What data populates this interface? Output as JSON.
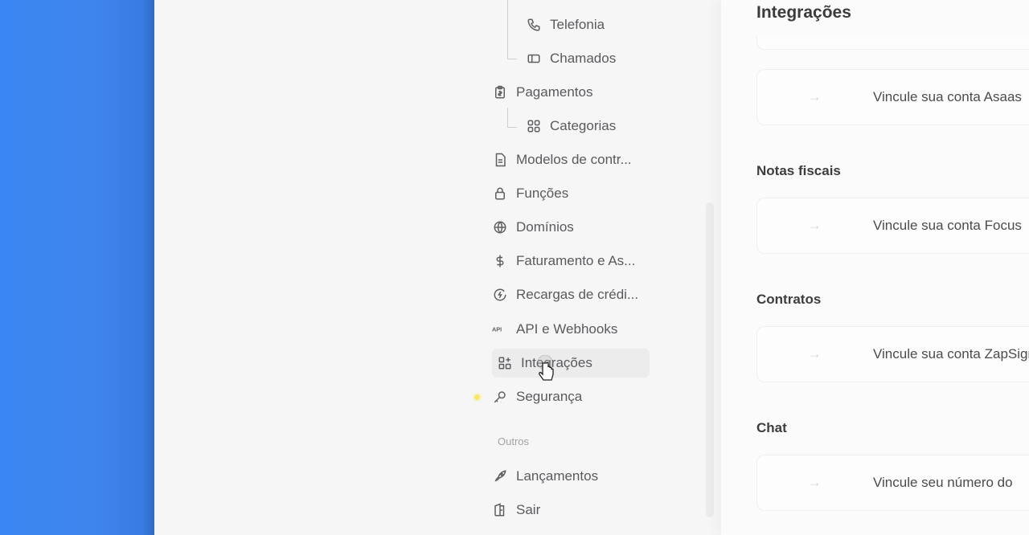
{
  "sidebar": {
    "items": [
      {
        "label": "Telefonia",
        "icon": "phone-icon"
      },
      {
        "label": "Chamados",
        "icon": "ticket-icon"
      },
      {
        "label": "Pagamentos",
        "icon": "clipboard-dollar-icon"
      },
      {
        "label": "Categorias",
        "icon": "grid-icon"
      },
      {
        "label": "Modelos de contr...",
        "icon": "document-icon"
      },
      {
        "label": "Funções",
        "icon": "lock-icon"
      },
      {
        "label": "Domínios",
        "icon": "globe-icon"
      },
      {
        "label": "Faturamento e As...",
        "icon": "dollar-icon"
      },
      {
        "label": "Recargas de crédi...",
        "icon": "recharge-icon"
      },
      {
        "label": "API e Webhooks",
        "icon": "api-icon"
      },
      {
        "label": "Integrações",
        "icon": "integrations-icon"
      },
      {
        "label": "Segurança",
        "icon": "key-icon"
      },
      {
        "label": "Lançamentos",
        "icon": "rocket-icon"
      },
      {
        "label": "Sair",
        "icon": "logout-icon"
      }
    ],
    "section_other": "Outros",
    "active": "Integrações"
  },
  "panel": {
    "title": "Integrações",
    "groups": [
      {
        "label": "",
        "card_text": "Vincule sua conta Asaas"
      },
      {
        "label": "Notas fiscais",
        "card_text": "Vincule sua conta Focus"
      },
      {
        "label": "Contratos",
        "card_text": "Vincule sua conta ZapSign"
      },
      {
        "label": "Chat",
        "card_text": "Vincule seu número do"
      }
    ],
    "arrow": "→"
  },
  "colors": {
    "accent_left": "#3a86f2",
    "text": "#585a5d"
  }
}
